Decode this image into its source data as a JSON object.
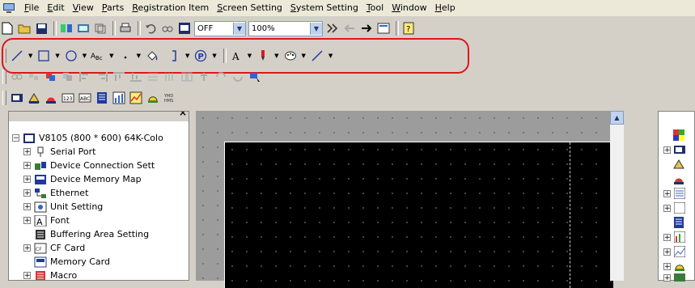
{
  "menubar": {
    "app_icon": "computer-icon",
    "items": [
      {
        "label": "File"
      },
      {
        "label": "Edit"
      },
      {
        "label": "View"
      },
      {
        "label": "Parts"
      },
      {
        "label": "Registration Item"
      },
      {
        "label": "Screen Setting"
      },
      {
        "label": "System Setting"
      },
      {
        "label": "Tool"
      },
      {
        "label": "Window"
      },
      {
        "label": "Help"
      }
    ]
  },
  "toolbar_standard": {
    "mode_value": "OFF",
    "zoom_value": "100%"
  },
  "toolbar_draw": {
    "text_sample": "A",
    "p_label": "P"
  },
  "tree": {
    "items": [
      {
        "label": "V8105 (800 * 600) 64K-Colo"
      },
      {
        "label": "Serial Port"
      },
      {
        "label": "Device Connection Sett"
      },
      {
        "label": "Device Memory Map"
      },
      {
        "label": "Ethernet"
      },
      {
        "label": "Unit Setting"
      },
      {
        "label": "Font"
      },
      {
        "label": "Buffering Area Setting"
      },
      {
        "label": "CF Card"
      },
      {
        "label": "Memory Card"
      },
      {
        "label": "Macro"
      }
    ]
  },
  "colors": {
    "highlight": "#e0161c",
    "canvas_bg": "#000000",
    "workspace": "#9c9c9c"
  }
}
